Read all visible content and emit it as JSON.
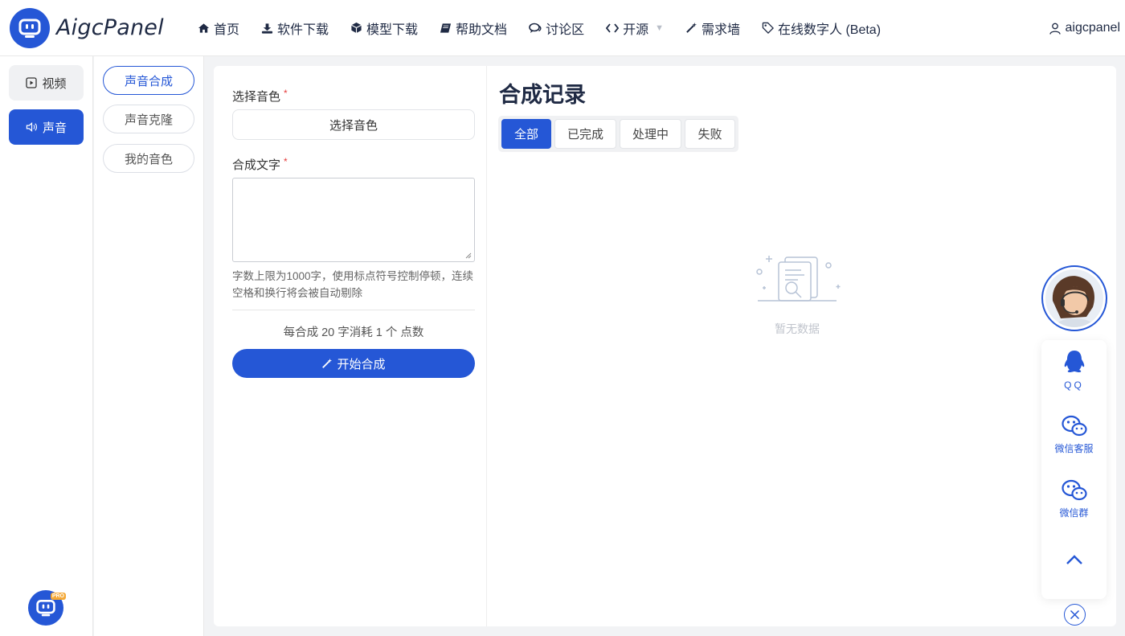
{
  "brand": {
    "name": "AigcPanel",
    "pro_badge": "PRO"
  },
  "nav": {
    "items": [
      {
        "label": "首页",
        "icon": "home-icon"
      },
      {
        "label": "软件下载",
        "icon": "download-icon"
      },
      {
        "label": "模型下载",
        "icon": "cube-icon"
      },
      {
        "label": "帮助文档",
        "icon": "book-icon"
      },
      {
        "label": "讨论区",
        "icon": "comments-icon"
      },
      {
        "label": "开源",
        "icon": "code-icon"
      },
      {
        "label": "需求墙",
        "icon": "magic-wand-icon"
      },
      {
        "label": "在线数字人 (Beta)",
        "icon": "tag-icon"
      }
    ],
    "user": "aigcpanel"
  },
  "rail": {
    "video": "视频",
    "voice": "声音"
  },
  "submenu": {
    "items": [
      "声音合成",
      "声音克隆",
      "我的音色"
    ],
    "active_index": 0
  },
  "form": {
    "voice_label": "选择音色",
    "voice_button": "选择音色",
    "text_label": "合成文字",
    "required_mark": "*",
    "text_value": "",
    "hint": "字数上限为1000字，使用标点符号控制停顿，连续空格和换行将会被自动剔除",
    "cost": "每合成 20 字消耗 1 个 点数",
    "start_button": "开始合成"
  },
  "records": {
    "title": "合成记录",
    "tabs": [
      "全部",
      "已完成",
      "处理中",
      "失败"
    ],
    "active_tab": 0,
    "empty_text": "暂无数据"
  },
  "float": {
    "qq": "QQ",
    "wechat_service": "微信客服",
    "wechat_group": "微信群"
  },
  "colors": {
    "primary": "#2557d6",
    "text": "#1f2a44",
    "muted": "#c0c4cc"
  }
}
